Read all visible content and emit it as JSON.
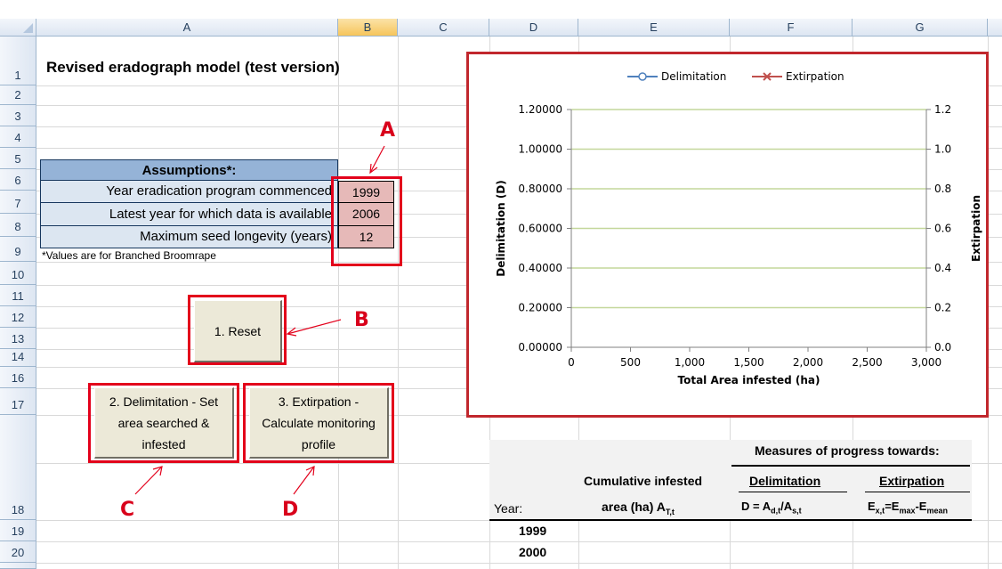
{
  "columns": [
    "A",
    "B",
    "C",
    "D",
    "E",
    "F",
    "G"
  ],
  "rows": [
    "1",
    "2",
    "3",
    "4",
    "5",
    "6",
    "7",
    "8",
    "9",
    "10",
    "11",
    "12",
    "13",
    "14",
    "16",
    "17",
    "18",
    "19",
    "20"
  ],
  "title": "Revised eradograph model (test version)",
  "assumptions": {
    "header": "Assumptions*:",
    "items": [
      {
        "label": "Year eradication program commenced",
        "value": "1999"
      },
      {
        "label": "Latest year for which data is available",
        "value": "2006"
      },
      {
        "label": "Maximum seed longevity (years)",
        "value": "12"
      }
    ],
    "footnote": "*Values are for Branched Broomrape"
  },
  "buttons": {
    "reset": "1. Reset",
    "delimitation": "2. Delimitation - Set area searched & infested",
    "extirpation": "3. Extirpation - Calculate monitoring profile"
  },
  "callouts": {
    "a": "A",
    "b": "B",
    "c": "C",
    "d": "D"
  },
  "table": {
    "measures_header": "Measures of progress towards:",
    "year_label": "Year:",
    "cumulative_line1": "Cumulative infested",
    "cumulative_line2": "area (ha) A",
    "cumulative_sub": "T,t",
    "delim_header": "Delimitation",
    "extirp_header": "Extirpation",
    "delim_formula": "D = A",
    "extirp_formula": "E",
    "years": [
      "1999",
      "2000"
    ]
  },
  "chart_data": {
    "type": "line",
    "xlabel": "Total Area infested (ha)",
    "ylabel": "Delimitation (D)",
    "y2label": "Extirpation",
    "xlim": [
      0,
      3000
    ],
    "ylim": [
      0,
      1.2
    ],
    "y2lim": [
      0,
      1.2
    ],
    "xticks": [
      "0",
      "500",
      "1,000",
      "1,500",
      "2,000",
      "2,500",
      "3,000"
    ],
    "yticks": [
      "0.00000",
      "0.20000",
      "0.40000",
      "0.60000",
      "0.80000",
      "1.00000",
      "1.20000"
    ],
    "y2ticks": [
      "0.0",
      "0.2",
      "0.4",
      "0.6",
      "0.8",
      "1.0",
      "1.2"
    ],
    "grid": true,
    "legend_position": "top",
    "series": [
      {
        "name": "Delimitation",
        "values": [],
        "color": "#4f81bd",
        "marker": "circle"
      },
      {
        "name": "Extirpation",
        "values": [],
        "color": "#c0504d",
        "marker": "x"
      }
    ]
  }
}
